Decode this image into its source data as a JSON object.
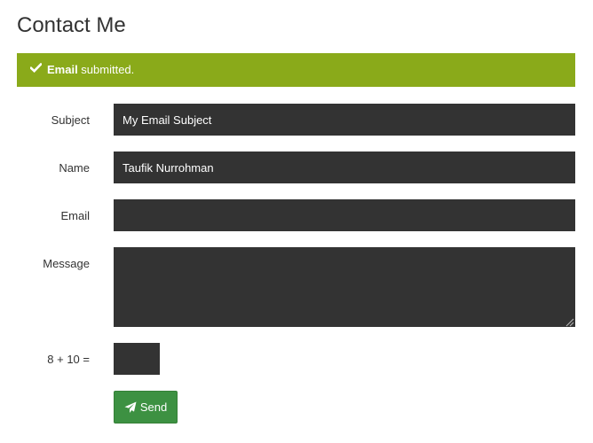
{
  "page": {
    "title": "Contact Me"
  },
  "alert": {
    "icon": "check-icon",
    "strong_text": "Email",
    "text": " submitted.",
    "color": "#8aaa1a"
  },
  "form": {
    "subject": {
      "label": "Subject",
      "value": "My Email Subject"
    },
    "name": {
      "label": "Name",
      "value": "Taufik Nurrohman"
    },
    "email": {
      "label": "Email",
      "value": ""
    },
    "message": {
      "label": "Message",
      "value": ""
    },
    "captcha": {
      "label": "8 + 10 =",
      "value": ""
    },
    "send_button": {
      "label": "Send",
      "icon": "paper-plane-icon",
      "color": "#3d9142"
    },
    "field_background": "#333333"
  }
}
